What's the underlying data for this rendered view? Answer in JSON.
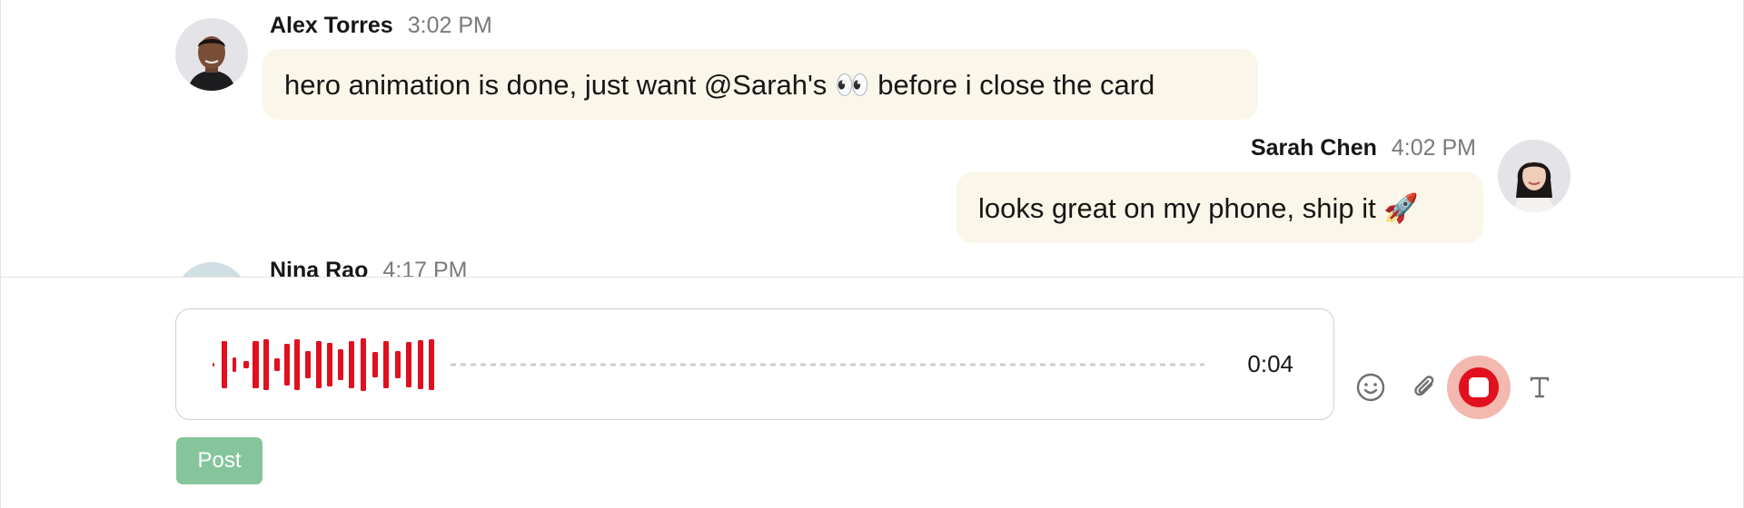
{
  "messages": [
    {
      "sender": "Alex Torres",
      "time": "3:02 PM",
      "text": "hero animation is done, just want @Sarah's 👀  before i close the card",
      "avatar_icon": "user-avatar-alex"
    },
    {
      "sender": "Sarah Chen",
      "time": "4:02 PM",
      "text": "looks great on my phone, ship it 🚀",
      "avatar_icon": "user-avatar-sarah"
    },
    {
      "sender": "Nina Rao",
      "time": "4:17 PM",
      "avatar_icon": "user-avatar-nina"
    }
  ],
  "composer": {
    "recording_time": "0:04",
    "waveform_color": "#e0101f",
    "post_label": "Post",
    "post_color": "#86c59c"
  },
  "toolbar": {
    "emoji_icon": "emoji-icon",
    "attach_icon": "paperclip-icon",
    "record_icon": "stop-recording-icon",
    "format_icon": "text-format-icon",
    "record_color": "#e0101f"
  },
  "colors": {
    "bubble_bg": "#fbf6ea",
    "time_text": "#7a7a7a"
  }
}
